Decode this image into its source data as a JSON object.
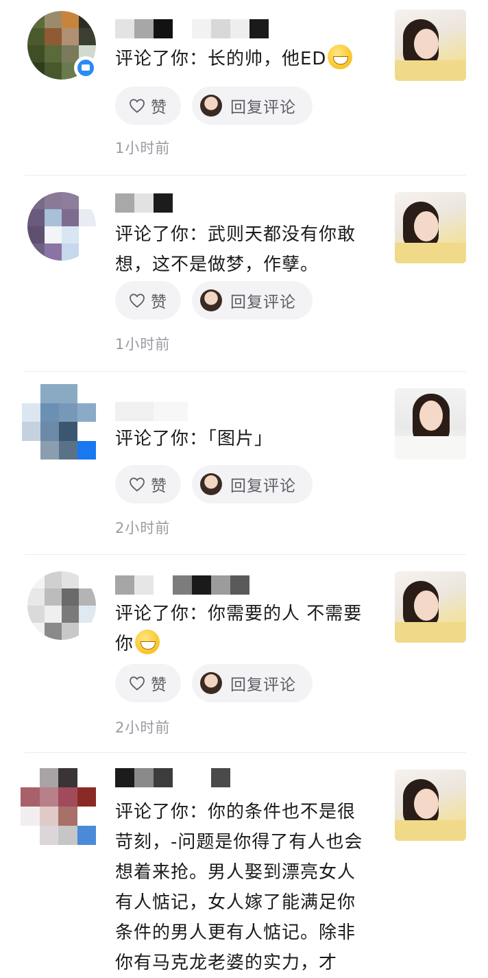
{
  "like_label": "赞",
  "reply_label": "回复评论",
  "accent_color": "#2b8af5",
  "items": [
    {
      "comment": "评论了你：长的帅，他ED",
      "emoji": "rolling-laughing-emoji",
      "time": "1小时前"
    },
    {
      "comment": "评论了你：武则天都没有你敢想，这不是做梦，作孽。",
      "time": "1小时前"
    },
    {
      "comment": "评论了你：「图片」",
      "time": "2小时前"
    },
    {
      "comment": "评论了你：你需要的人 不需要你",
      "emoji": "grinning-emoji",
      "time": "2小时前"
    },
    {
      "comment": "评论了你：你的条件也不是很苛刻，-问题是你得了有人也会想着来抢。男人娶到漂亮女人有人惦记，女人嫁了能满足你条件的男人更有人惦记。除非你有马克龙老婆的实力，才"
    }
  ]
}
